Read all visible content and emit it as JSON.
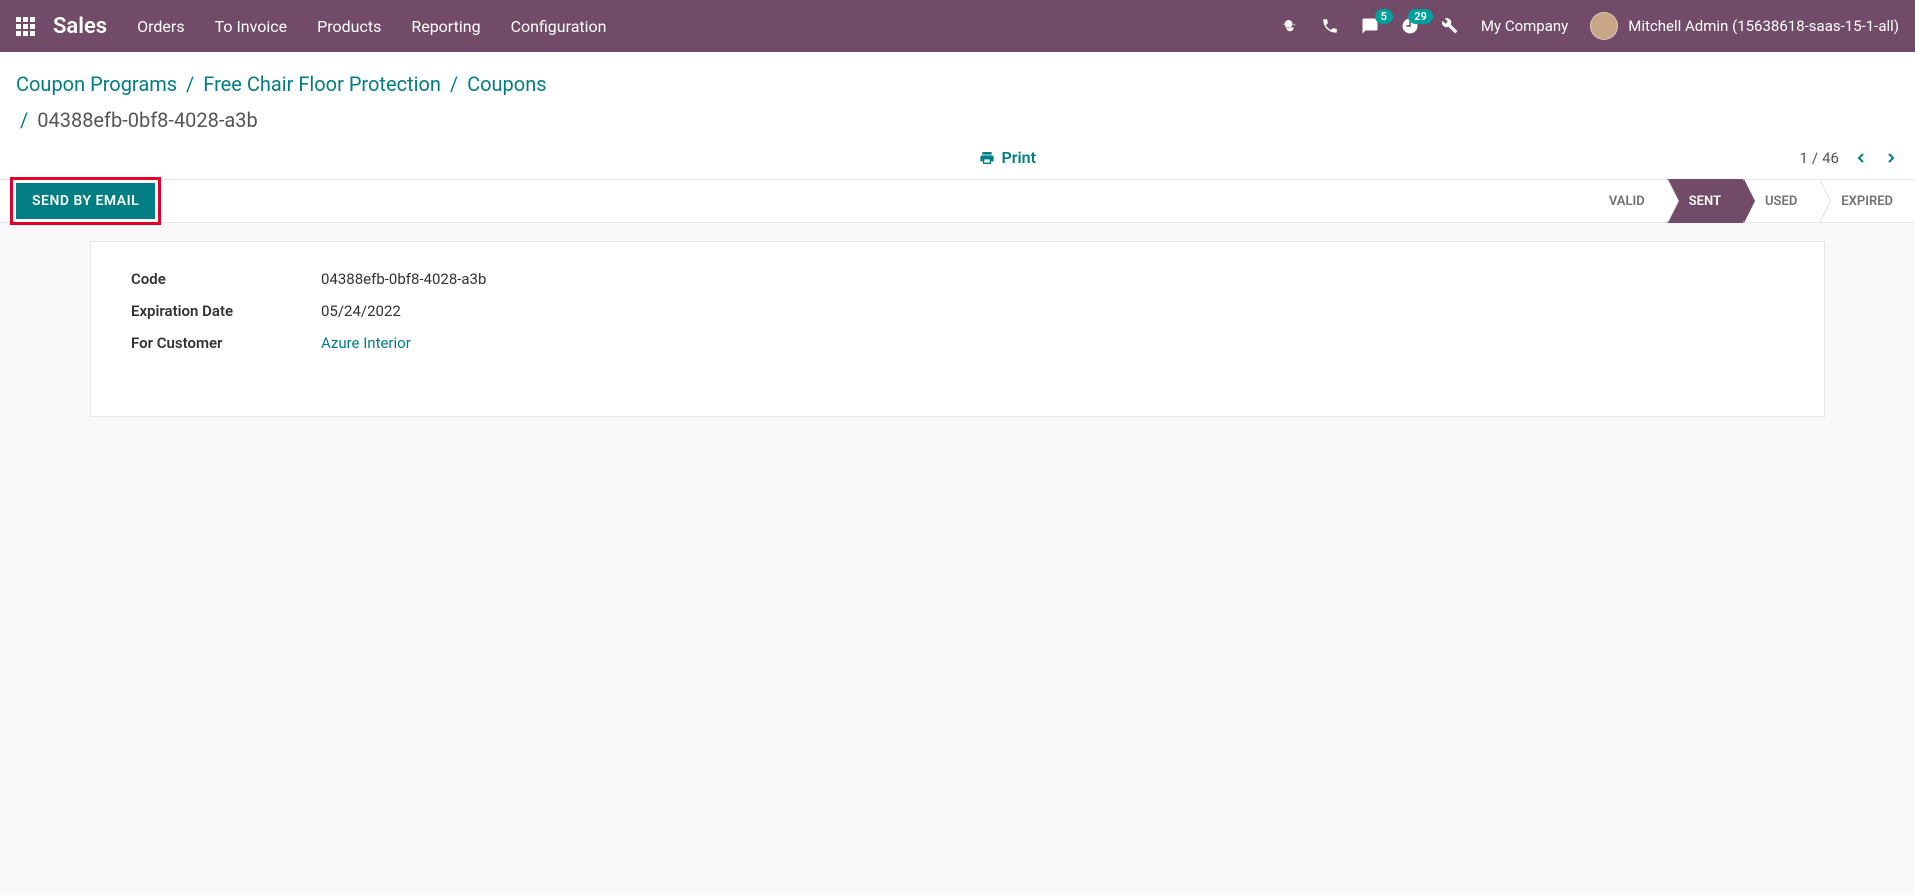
{
  "topbar": {
    "app_name": "Sales",
    "menu": [
      "Orders",
      "To Invoice",
      "Products",
      "Reporting",
      "Configuration"
    ],
    "messaging_badge": "5",
    "activity_badge": "29",
    "company": "My Company",
    "user": "Mitchell Admin (15638618-saas-15-1-all)"
  },
  "breadcrumb": {
    "parts": [
      "Coupon Programs",
      "Free Chair Floor Protection",
      "Coupons"
    ],
    "current": "04388efb-0bf8-4028-a3b"
  },
  "print_label": "Print",
  "pager": {
    "current": "1",
    "sep": "/",
    "total": "46"
  },
  "buttons": {
    "send_email": "SEND BY EMAIL"
  },
  "status_chain": [
    "VALID",
    "SENT",
    "USED",
    "EXPIRED"
  ],
  "status_active_index": 1,
  "fields": {
    "code_label": "Code",
    "code_value": "04388efb-0bf8-4028-a3b",
    "expiry_label": "Expiration Date",
    "expiry_value": "05/24/2022",
    "customer_label": "For Customer",
    "customer_value": "Azure Interior"
  }
}
